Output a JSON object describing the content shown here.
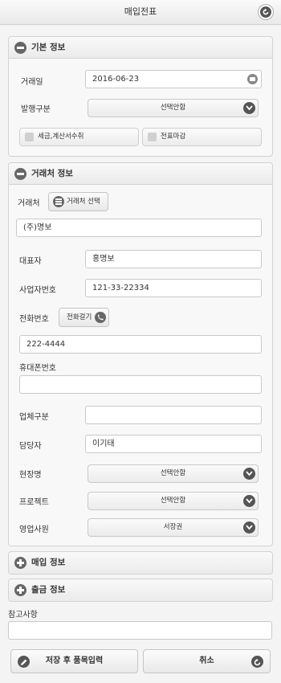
{
  "header": {
    "title": "매입전표"
  },
  "basic": {
    "title": "기본 정보",
    "trade_date_label": "거래일",
    "trade_date_value": "2016-06-23",
    "issue_type_label": "발행구분",
    "issue_type_value": "선택안함",
    "tax_invoice_label": "세금,계산서수취",
    "slip_close_label": "전표마감"
  },
  "partner": {
    "title": "거래처 정보",
    "partner_label": "거래처",
    "partner_select_label": "거래처 선택",
    "partner_value": "(주)명보",
    "ceo_label": "대표자",
    "ceo_value": "홍명보",
    "bizno_label": "사업자번호",
    "bizno_value": "121-33-22334",
    "phone_label": "전화번호",
    "call_button_label": "전화걸기",
    "phone_value": "222-4444",
    "mobile_label": "휴대폰번호",
    "mobile_value": "",
    "biztype_label": "업체구분",
    "biztype_value": "",
    "manager_label": "담당자",
    "manager_value": "이기태",
    "site_label": "현장명",
    "site_value": "선택안함",
    "project_label": "프로젝트",
    "project_value": "선택안함",
    "sales_label": "영업사원",
    "sales_value": "서장권"
  },
  "purchase": {
    "title": "매입 정보"
  },
  "shipment": {
    "title": "출금 정보"
  },
  "note": {
    "label": "참고사항",
    "value": ""
  },
  "actions": {
    "save_label": "저장 후 품목입력",
    "cancel_label": "취소"
  }
}
